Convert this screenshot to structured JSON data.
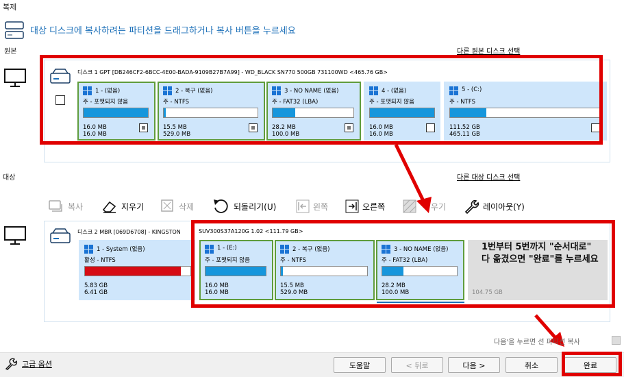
{
  "window": {
    "title": "복제"
  },
  "instruction": "대상 디스크에 복사하려는 파티션을 드래그하거나 복사 버튼을 누르세요",
  "source": {
    "label": "원본",
    "select_link": "다른 원본 디스크 선택",
    "disk_title": "디스크 1 GPT [DB246CF2-6BCC-4E00-BADA-9109B27B7A99] - WD_BLACK SN770 500GB 731100WD  <465.76 GB>",
    "partitions": [
      {
        "name": "1 - (없음)",
        "type": "주 - 포맷되지 않음",
        "used": "16.0 MB",
        "total": "16.0 MB",
        "fill": 1.0,
        "selected": true,
        "checked": true
      },
      {
        "name": "2 - 복구 (없음)",
        "type": "주 - NTFS",
        "used": "15.5 MB",
        "total": "529.0 MB",
        "fill": 0.02,
        "selected": true,
        "checked": true
      },
      {
        "name": "3 - NO NAME (없음)",
        "type": "주 - FAT32 (LBA)",
        "used": "28.2 MB",
        "total": "100.0 MB",
        "fill": 0.28,
        "selected": true,
        "checked": true
      },
      {
        "name": "4 - (없음)",
        "type": "주 - 포맷되지 않음",
        "used": "16.0 MB",
        "total": "16.0 MB",
        "fill": 1.0,
        "selected": false,
        "checked": false
      },
      {
        "name": "5 - (C:)",
        "type": "주 - NTFS",
        "used": "111.52 GB",
        "total": "465.11 GB",
        "fill": 0.24,
        "selected": false,
        "checked": false
      }
    ]
  },
  "target": {
    "label": "대상",
    "select_link": "다른 대상 디스크 선택",
    "disk_title_a": "디스크 2 MBR [069D6708] - KINGSTON",
    "disk_title_b": "SUV300S37A120G  1.02  <111.79 GB>",
    "partitions": [
      {
        "name": "1 - System (없음)",
        "type": "활성 - NTFS",
        "used": "5.83 GB",
        "total": "6.41 GB",
        "fill": 0.91,
        "bar_color": "#d60b14"
      },
      {
        "name": "1 - (E:)",
        "type": "주 - 포맷되지 않음",
        "used": "16.0 MB",
        "total": "16.0 MB",
        "fill": 1.0
      },
      {
        "name": "2 - 복구 (없음)",
        "type": "주 - NTFS",
        "used": "15.5 MB",
        "total": "529.0 MB",
        "fill": 0.02
      },
      {
        "name": "3 - NO NAME (없음)",
        "type": "주 - FAT32 (LBA)",
        "used": "28.2 MB",
        "total": "100.0 MB",
        "fill": 0.28
      }
    ],
    "free_space": "104.75 GB"
  },
  "toolbar": {
    "copy": "복사",
    "erase": "지우기",
    "delete": "삭제",
    "revert": "되돌리기(U)",
    "left": "왼쪽",
    "right": "오른쪽",
    "fill": "우기",
    "layout": "레이아웃(Y)"
  },
  "annotation": "1번부터 5번까지 \"순서대로\"\n다 옮겼으면 \"완료\"를 누르세요",
  "footer_option": "다음'을 누르면 선       파티션 복사",
  "buttons": {
    "advanced": "고급 옵션",
    "help": "도움말",
    "back": "< 뒤로",
    "next": "다음 >",
    "cancel": "취소",
    "finish": "완료"
  },
  "colors": {
    "accent": "#1b6fb8",
    "highlight": "#e00000",
    "selected_border": "#5f9c3c",
    "partition_bg": "#cfe6fb"
  }
}
